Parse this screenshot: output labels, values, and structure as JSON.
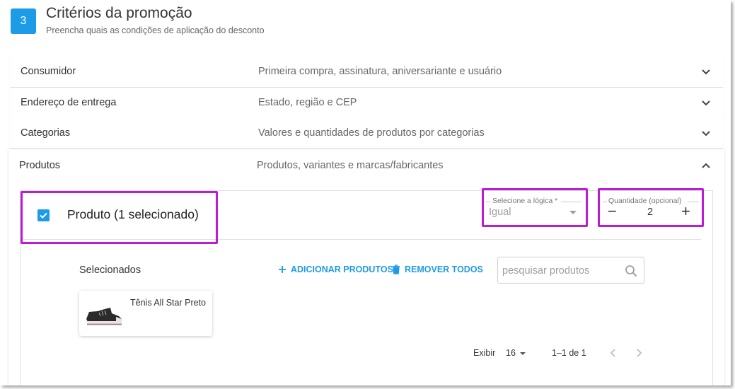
{
  "header": {
    "step": "3",
    "title": "Critérios da promoção",
    "subtitle": "Preencha quais as condições de aplicação do desconto"
  },
  "accordion": [
    {
      "label": "Consumidor",
      "description": "Primeira compra, assinatura, aniversariante e usuário",
      "expanded": false
    },
    {
      "label": "Endereço de entrega",
      "description": "Estado, região e CEP",
      "expanded": false
    },
    {
      "label": "Categorias",
      "description": "Valores e quantidades de produtos por categorias",
      "expanded": false
    },
    {
      "label": "Produtos",
      "description": "Produtos, variantes e marcas/fabricantes",
      "expanded": true
    }
  ],
  "produtos": {
    "checked": true,
    "title": "Produto (1 selecionado)",
    "logic": {
      "label": "Selecione a lógica *",
      "value": "Igual"
    },
    "quantity": {
      "label": "Quantidade (opcional)",
      "value": "2",
      "minus": "−",
      "plus": "+"
    },
    "selected_label": "Selecionados",
    "add_button": "ADICIONAR PRODUTOS",
    "remove_button": "REMOVER TODOS",
    "search_placeholder": "pesquisar produtos",
    "items": [
      {
        "name": "Tênis All Star Preto"
      }
    ],
    "pagination": {
      "show_label": "Exibir",
      "page_size": "16",
      "range": "1–1 de 1"
    }
  },
  "colors": {
    "accent": "#1e9be6",
    "highlight": "#bb1cd4"
  }
}
